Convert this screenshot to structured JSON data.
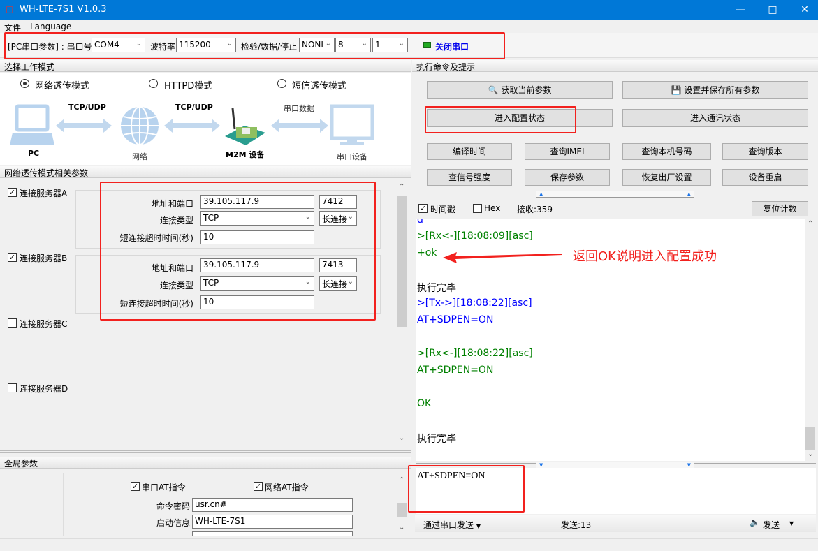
{
  "window": {
    "title": "WH-LTE-7S1 V1.0.3"
  },
  "menu": [
    "文件",
    "Language"
  ],
  "toolbar": {
    "pc_serial_label": "[PC串口参数] : 串口号",
    "port": "COM4",
    "baud_label": "波特率",
    "baud": "115200",
    "parity_label": "检验/数据/停止",
    "parity": "NONI",
    "data_bits": "8",
    "stop_bits": "1",
    "close_port": "关闭串口",
    "status_color": "#22aa22"
  },
  "mode": {
    "header": "选择工作模式",
    "options": [
      {
        "label": "网络透传模式",
        "selected": true
      },
      {
        "label": "HTTPD模式",
        "selected": false
      },
      {
        "label": "短信透传模式",
        "selected": false
      }
    ],
    "diagram": {
      "pc": "PC",
      "net": "网络",
      "m2m": "M2M 设备",
      "serial_dev": "串口设备",
      "link1": "TCP/UDP",
      "link2": "TCP/UDP",
      "link3": "串口数据"
    }
  },
  "params": {
    "header": "网络透传模式相关参数",
    "servers": [
      {
        "label": "连接服务器A",
        "checked": true,
        "addr_label": "地址和端口",
        "addr": "39.105.117.9",
        "port": "7412",
        "type_label": "连接类型",
        "type": "TCP",
        "conn": "长连接",
        "timeout_label": "短连接超时时间(秒)",
        "timeout": "10"
      },
      {
        "label": "连接服务器B",
        "checked": true,
        "addr_label": "地址和端口",
        "addr": "39.105.117.9",
        "port": "7413",
        "type_label": "连接类型",
        "type": "TCP",
        "conn": "长连接",
        "timeout_label": "短连接超时时间(秒)",
        "timeout": "10"
      },
      {
        "label": "连接服务器C",
        "checked": false
      },
      {
        "label": "连接服务器D",
        "checked": false
      }
    ]
  },
  "global": {
    "header": "全局参数",
    "serial_at": "串口AT指令",
    "net_at": "网络AT指令",
    "pwd_label": "命令密码",
    "pwd": "usr.cn#",
    "boot_label": "启动信息",
    "boot": "WH-LTE-7S1"
  },
  "commands": {
    "header": "执行命令及提示",
    "get_params": "获取当前参数",
    "save_all": "设置并保存所有参数",
    "enter_config": "进入配置状态",
    "enter_comm": "进入通讯状态",
    "row3": [
      "编译时间",
      "查询IMEI",
      "查询本机号码",
      "查询版本"
    ],
    "row4": [
      "查信号强度",
      "保存参数",
      "恢复出厂设置",
      "设备重启"
    ]
  },
  "log": {
    "timestamp": "时间戳",
    "hex": "Hex",
    "recv": "接收:359",
    "reset": "复位计数",
    "lines": [
      {
        "t": "d",
        "c": "blue"
      },
      {
        "t": ">[Rx<-][18:08:09][asc]",
        "c": "green"
      },
      {
        "t": "+ok",
        "c": "green"
      },
      {
        "t": "执行完毕",
        "c": "black"
      },
      {
        "t": ">[Tx->][18:08:22][asc]",
        "c": "blue"
      },
      {
        "t": "AT+SDPEN=ON",
        "c": "blue"
      },
      {
        "t": ">[Rx<-][18:08:22][asc]",
        "c": "green"
      },
      {
        "t": "AT+SDPEN=ON",
        "c": "green"
      },
      {
        "t": "OK",
        "c": "green"
      },
      {
        "t": "执行完毕",
        "c": "black"
      }
    ],
    "annotation": "返回OK说明进入配置成功"
  },
  "send": {
    "input": "AT+SDPEN=ON",
    "via": "通过串口发送",
    "count": "发送:13",
    "send": "发送"
  }
}
